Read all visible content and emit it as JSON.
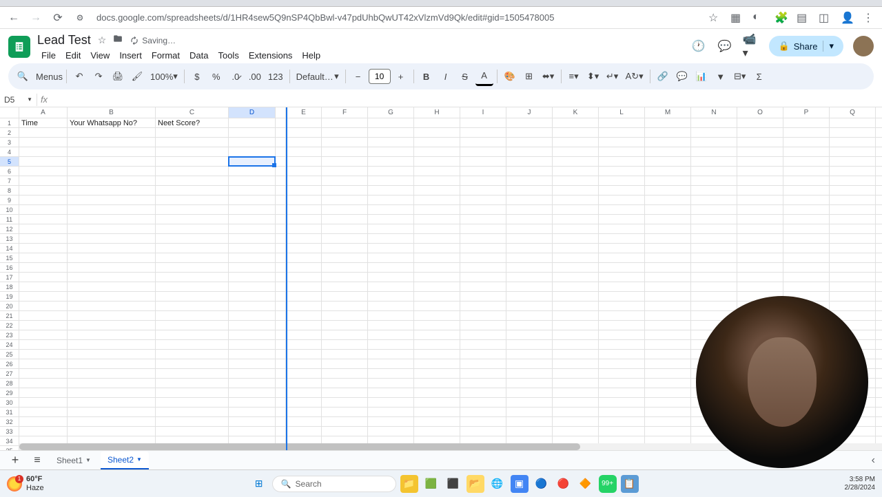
{
  "url": "docs.google.com/spreadsheets/d/1HR4sew5Q9nSP4QbBwl-v47pdUhbQwUT42xVlzmVd9Qk/edit#gid=1505478005",
  "doc": {
    "title": "Lead Test",
    "saving": "Saving…"
  },
  "menus": [
    "File",
    "Edit",
    "View",
    "Insert",
    "Format",
    "Data",
    "Tools",
    "Extensions",
    "Help"
  ],
  "toolbar": {
    "menus_label": "Menus",
    "zoom": "100%",
    "font": "Default…",
    "font_size": "10"
  },
  "share_label": "Share",
  "namebox": "D5",
  "columns": [
    {
      "l": "A",
      "w": 70
    },
    {
      "l": "B",
      "w": 128
    },
    {
      "l": "C",
      "w": 106
    },
    {
      "l": "D",
      "w": 68,
      "sel": true
    },
    {
      "l": "E",
      "w": 15
    },
    {
      "l": "E",
      "w": 52
    },
    {
      "l": "F",
      "w": 67
    },
    {
      "l": "G",
      "w": 67
    },
    {
      "l": "H",
      "w": 67
    },
    {
      "l": "I",
      "w": 67
    },
    {
      "l": "J",
      "w": 67
    },
    {
      "l": "K",
      "w": 67
    },
    {
      "l": "L",
      "w": 67
    },
    {
      "l": "M",
      "w": 67
    },
    {
      "l": "N",
      "w": 67
    },
    {
      "l": "O",
      "w": 67
    },
    {
      "l": "P",
      "w": 67
    },
    {
      "l": "Q",
      "w": 67
    }
  ],
  "headers_row": {
    "A": "Time",
    "B": "Your Whatsapp No?",
    "C": "Neet Score?"
  },
  "row_count": 35,
  "selected_row": 5,
  "sheets": [
    {
      "name": "Sheet1",
      "active": false
    },
    {
      "name": "Sheet2",
      "active": true
    }
  ],
  "taskbar": {
    "temp": "60°F",
    "cond": "Haze",
    "search_ph": "Search",
    "time": "3:58 PM",
    "date": "2/28/2024"
  }
}
